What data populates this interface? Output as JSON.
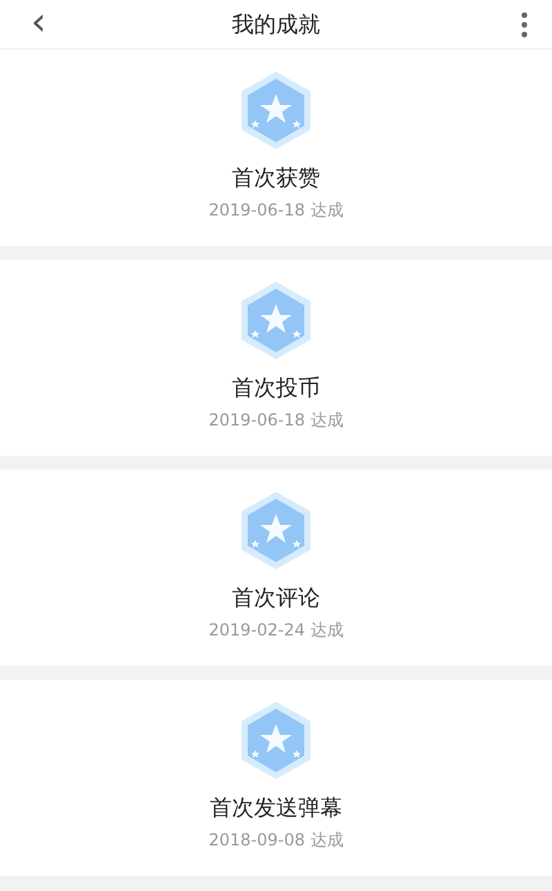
{
  "header": {
    "back": "‹",
    "title": "我的成就"
  },
  "achievements": [
    {
      "name": "首次获赞",
      "date": "2019-06-18 达成"
    },
    {
      "name": "首次投币",
      "date": "2019-06-18 达成"
    },
    {
      "name": "首次评论",
      "date": "2019-02-24 达成"
    },
    {
      "name": "首次发送弹幕",
      "date": "2018-09-08 达成"
    }
  ]
}
